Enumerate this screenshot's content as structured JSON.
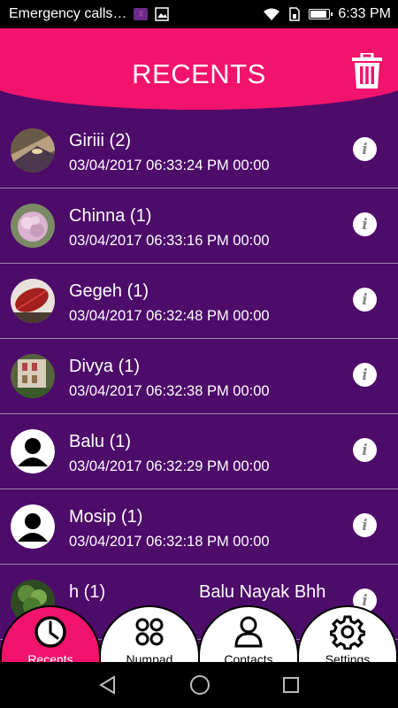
{
  "status_bar": {
    "notification_text": "Emergency calls…",
    "time": "6:33 PM",
    "battery_level": 0.9,
    "icons": [
      "app-notification-icon",
      "image-icon",
      "wifi-icon",
      "sim-icon",
      "battery-icon"
    ]
  },
  "header": {
    "title": "RECENTS",
    "delete_icon": "trash-icon",
    "accent_color": "#f2136d"
  },
  "theme": {
    "background": "#4d0b6a",
    "divider": "#9b86aa"
  },
  "recents": [
    {
      "name": "Giriii (2)",
      "meta": "03/04/2017 06:33:24 PM 00:00",
      "avatar": "photo-blurry"
    },
    {
      "name": "Chinna (1)",
      "meta": "03/04/2017 06:33:16 PM 00:00",
      "avatar": "photo-flower"
    },
    {
      "name": "Gegeh (1)",
      "meta": "03/04/2017 06:32:48 PM 00:00",
      "avatar": "photo-leaf"
    },
    {
      "name": "Divya (1)",
      "meta": "03/04/2017 06:32:38 PM 00:00",
      "avatar": "photo-building"
    },
    {
      "name": "Balu (1)",
      "meta": "03/04/2017 06:32:29 PM 00:00",
      "avatar": "default-person"
    },
    {
      "name": "Mosip (1)",
      "meta": "03/04/2017 06:32:18 PM 00:00",
      "avatar": "default-person"
    },
    {
      "name": "h (1)",
      "extra": "Balu Nayak Bhh",
      "avatar": "photo-plant"
    }
  ],
  "tabs": [
    {
      "label": "Recents",
      "icon": "clock-icon",
      "active": true
    },
    {
      "label": "Numpad",
      "icon": "numpad-icon",
      "active": false
    },
    {
      "label": "Contacts",
      "icon": "contact-icon",
      "active": false
    },
    {
      "label": "Settings",
      "icon": "gear-icon",
      "active": false
    }
  ],
  "nav": [
    "back-icon",
    "home-icon",
    "recents-square-icon"
  ]
}
